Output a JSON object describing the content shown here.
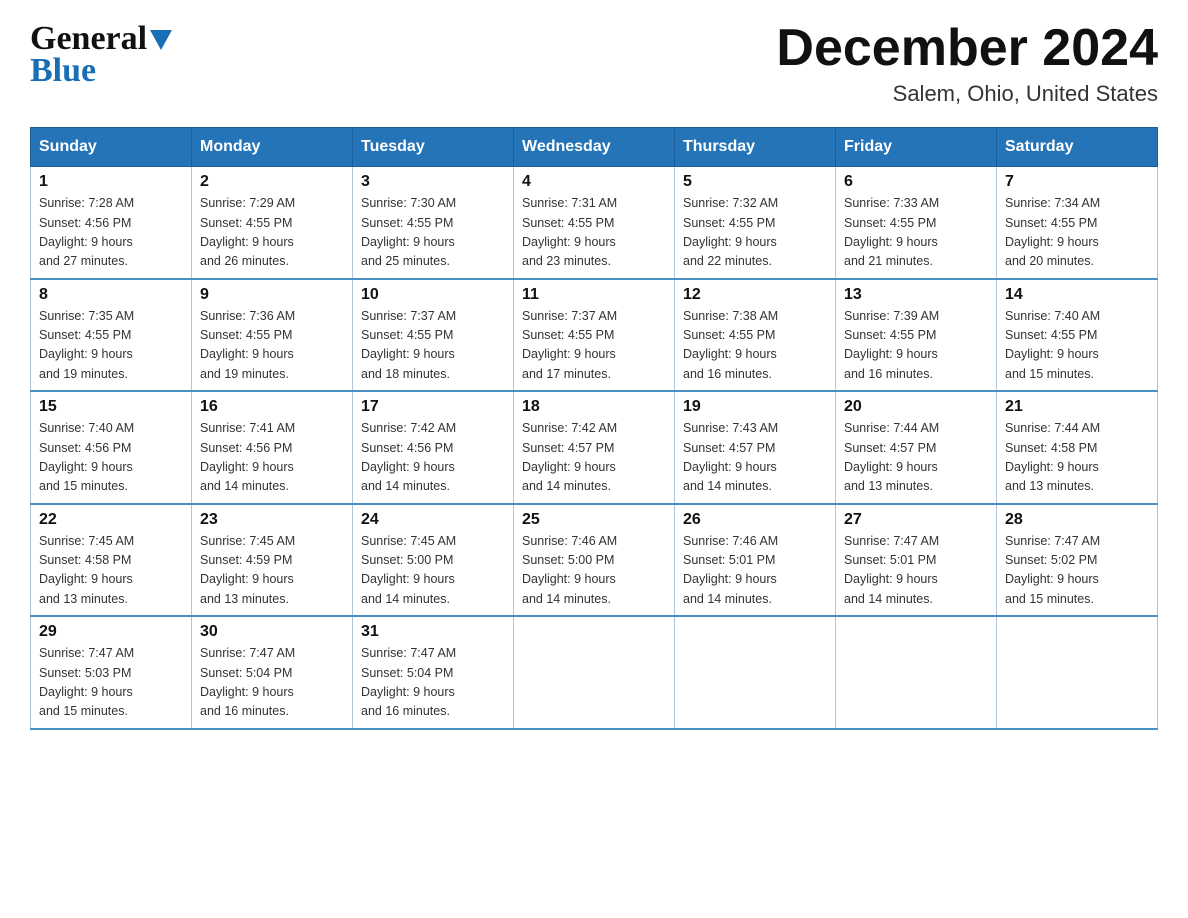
{
  "header": {
    "logo_general": "General",
    "logo_blue": "Blue",
    "title": "December 2024",
    "subtitle": "Salem, Ohio, United States"
  },
  "days_of_week": [
    "Sunday",
    "Monday",
    "Tuesday",
    "Wednesday",
    "Thursday",
    "Friday",
    "Saturday"
  ],
  "weeks": [
    [
      {
        "day": "1",
        "sunrise": "Sunrise: 7:28 AM",
        "sunset": "Sunset: 4:56 PM",
        "daylight": "Daylight: 9 hours",
        "daylight2": "and 27 minutes."
      },
      {
        "day": "2",
        "sunrise": "Sunrise: 7:29 AM",
        "sunset": "Sunset: 4:55 PM",
        "daylight": "Daylight: 9 hours",
        "daylight2": "and 26 minutes."
      },
      {
        "day": "3",
        "sunrise": "Sunrise: 7:30 AM",
        "sunset": "Sunset: 4:55 PM",
        "daylight": "Daylight: 9 hours",
        "daylight2": "and 25 minutes."
      },
      {
        "day": "4",
        "sunrise": "Sunrise: 7:31 AM",
        "sunset": "Sunset: 4:55 PM",
        "daylight": "Daylight: 9 hours",
        "daylight2": "and 23 minutes."
      },
      {
        "day": "5",
        "sunrise": "Sunrise: 7:32 AM",
        "sunset": "Sunset: 4:55 PM",
        "daylight": "Daylight: 9 hours",
        "daylight2": "and 22 minutes."
      },
      {
        "day": "6",
        "sunrise": "Sunrise: 7:33 AM",
        "sunset": "Sunset: 4:55 PM",
        "daylight": "Daylight: 9 hours",
        "daylight2": "and 21 minutes."
      },
      {
        "day": "7",
        "sunrise": "Sunrise: 7:34 AM",
        "sunset": "Sunset: 4:55 PM",
        "daylight": "Daylight: 9 hours",
        "daylight2": "and 20 minutes."
      }
    ],
    [
      {
        "day": "8",
        "sunrise": "Sunrise: 7:35 AM",
        "sunset": "Sunset: 4:55 PM",
        "daylight": "Daylight: 9 hours",
        "daylight2": "and 19 minutes."
      },
      {
        "day": "9",
        "sunrise": "Sunrise: 7:36 AM",
        "sunset": "Sunset: 4:55 PM",
        "daylight": "Daylight: 9 hours",
        "daylight2": "and 19 minutes."
      },
      {
        "day": "10",
        "sunrise": "Sunrise: 7:37 AM",
        "sunset": "Sunset: 4:55 PM",
        "daylight": "Daylight: 9 hours",
        "daylight2": "and 18 minutes."
      },
      {
        "day": "11",
        "sunrise": "Sunrise: 7:37 AM",
        "sunset": "Sunset: 4:55 PM",
        "daylight": "Daylight: 9 hours",
        "daylight2": "and 17 minutes."
      },
      {
        "day": "12",
        "sunrise": "Sunrise: 7:38 AM",
        "sunset": "Sunset: 4:55 PM",
        "daylight": "Daylight: 9 hours",
        "daylight2": "and 16 minutes."
      },
      {
        "day": "13",
        "sunrise": "Sunrise: 7:39 AM",
        "sunset": "Sunset: 4:55 PM",
        "daylight": "Daylight: 9 hours",
        "daylight2": "and 16 minutes."
      },
      {
        "day": "14",
        "sunrise": "Sunrise: 7:40 AM",
        "sunset": "Sunset: 4:55 PM",
        "daylight": "Daylight: 9 hours",
        "daylight2": "and 15 minutes."
      }
    ],
    [
      {
        "day": "15",
        "sunrise": "Sunrise: 7:40 AM",
        "sunset": "Sunset: 4:56 PM",
        "daylight": "Daylight: 9 hours",
        "daylight2": "and 15 minutes."
      },
      {
        "day": "16",
        "sunrise": "Sunrise: 7:41 AM",
        "sunset": "Sunset: 4:56 PM",
        "daylight": "Daylight: 9 hours",
        "daylight2": "and 14 minutes."
      },
      {
        "day": "17",
        "sunrise": "Sunrise: 7:42 AM",
        "sunset": "Sunset: 4:56 PM",
        "daylight": "Daylight: 9 hours",
        "daylight2": "and 14 minutes."
      },
      {
        "day": "18",
        "sunrise": "Sunrise: 7:42 AM",
        "sunset": "Sunset: 4:57 PM",
        "daylight": "Daylight: 9 hours",
        "daylight2": "and 14 minutes."
      },
      {
        "day": "19",
        "sunrise": "Sunrise: 7:43 AM",
        "sunset": "Sunset: 4:57 PM",
        "daylight": "Daylight: 9 hours",
        "daylight2": "and 14 minutes."
      },
      {
        "day": "20",
        "sunrise": "Sunrise: 7:44 AM",
        "sunset": "Sunset: 4:57 PM",
        "daylight": "Daylight: 9 hours",
        "daylight2": "and 13 minutes."
      },
      {
        "day": "21",
        "sunrise": "Sunrise: 7:44 AM",
        "sunset": "Sunset: 4:58 PM",
        "daylight": "Daylight: 9 hours",
        "daylight2": "and 13 minutes."
      }
    ],
    [
      {
        "day": "22",
        "sunrise": "Sunrise: 7:45 AM",
        "sunset": "Sunset: 4:58 PM",
        "daylight": "Daylight: 9 hours",
        "daylight2": "and 13 minutes."
      },
      {
        "day": "23",
        "sunrise": "Sunrise: 7:45 AM",
        "sunset": "Sunset: 4:59 PM",
        "daylight": "Daylight: 9 hours",
        "daylight2": "and 13 minutes."
      },
      {
        "day": "24",
        "sunrise": "Sunrise: 7:45 AM",
        "sunset": "Sunset: 5:00 PM",
        "daylight": "Daylight: 9 hours",
        "daylight2": "and 14 minutes."
      },
      {
        "day": "25",
        "sunrise": "Sunrise: 7:46 AM",
        "sunset": "Sunset: 5:00 PM",
        "daylight": "Daylight: 9 hours",
        "daylight2": "and 14 minutes."
      },
      {
        "day": "26",
        "sunrise": "Sunrise: 7:46 AM",
        "sunset": "Sunset: 5:01 PM",
        "daylight": "Daylight: 9 hours",
        "daylight2": "and 14 minutes."
      },
      {
        "day": "27",
        "sunrise": "Sunrise: 7:47 AM",
        "sunset": "Sunset: 5:01 PM",
        "daylight": "Daylight: 9 hours",
        "daylight2": "and 14 minutes."
      },
      {
        "day": "28",
        "sunrise": "Sunrise: 7:47 AM",
        "sunset": "Sunset: 5:02 PM",
        "daylight": "Daylight: 9 hours",
        "daylight2": "and 15 minutes."
      }
    ],
    [
      {
        "day": "29",
        "sunrise": "Sunrise: 7:47 AM",
        "sunset": "Sunset: 5:03 PM",
        "daylight": "Daylight: 9 hours",
        "daylight2": "and 15 minutes."
      },
      {
        "day": "30",
        "sunrise": "Sunrise: 7:47 AM",
        "sunset": "Sunset: 5:04 PM",
        "daylight": "Daylight: 9 hours",
        "daylight2": "and 16 minutes."
      },
      {
        "day": "31",
        "sunrise": "Sunrise: 7:47 AM",
        "sunset": "Sunset: 5:04 PM",
        "daylight": "Daylight: 9 hours",
        "daylight2": "and 16 minutes."
      },
      null,
      null,
      null,
      null
    ]
  ],
  "colors": {
    "header_bg": "#2574b8",
    "header_text": "#ffffff",
    "border_color": "#4a90c4",
    "cell_border": "#b0c4d8"
  }
}
